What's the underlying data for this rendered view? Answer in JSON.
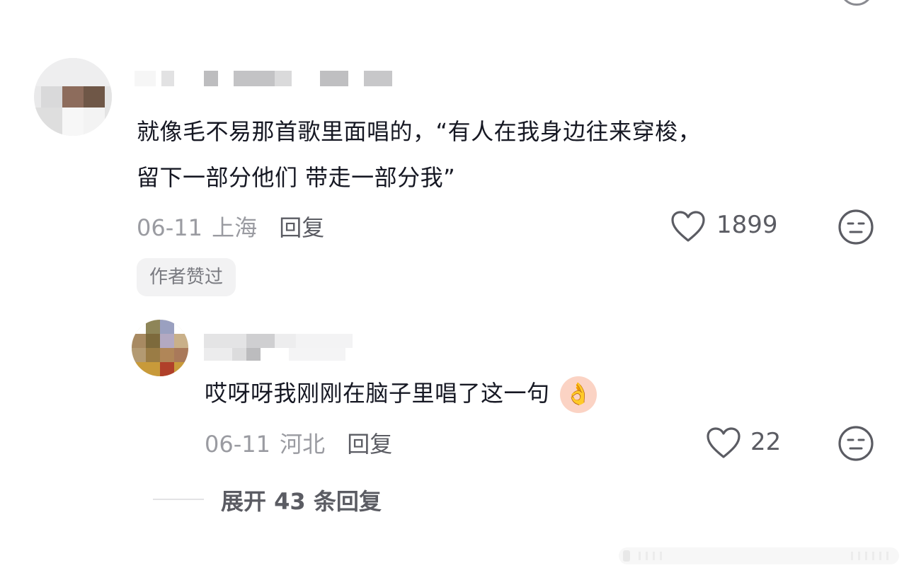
{
  "comments": [
    {
      "text_line1": "就像毛不易那首歌里面唱的，“有人在我身边往来穿梭，",
      "text_line2": "留下一部分他们 带走一部分我”",
      "date": "06-11",
      "location": "上海",
      "reply_label": "回复",
      "likes": "1899",
      "badge": "作者赞过",
      "replies": [
        {
          "text": "哎呀呀我刚刚在脑子里唱了这一句",
          "emoji": "👌",
          "date": "06-11",
          "location": "河北",
          "reply_label": "回复",
          "likes": "22"
        }
      ],
      "expand_label": "展开 43 条回复"
    }
  ],
  "icons": {
    "like": "heart-outline-icon",
    "react": "neutral-face-icon"
  },
  "colors": {
    "text": "#161823",
    "meta": "#9a9ba1",
    "action": "#5b5c63",
    "badge_bg": "#f2f2f3"
  }
}
